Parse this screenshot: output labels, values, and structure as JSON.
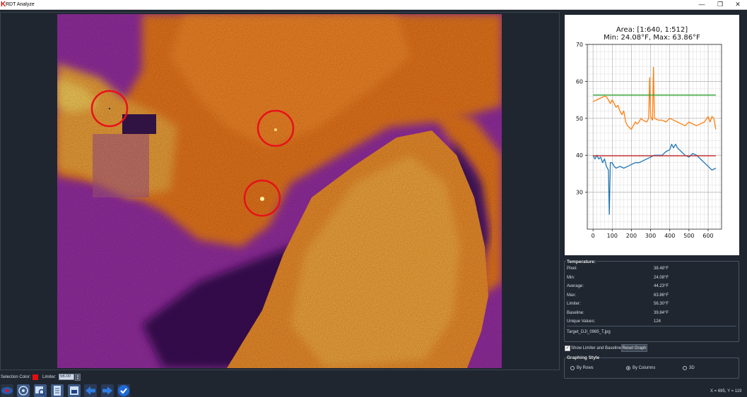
{
  "window": {
    "title": "RDT Analyze",
    "controls": {
      "minimize": "—",
      "maximize": "❐",
      "close": "✕"
    }
  },
  "graph": {
    "title_line1": "Area: [1:640, 1:512]",
    "title_line2": "Min: 24.08°F, Max: 63.86°F"
  },
  "chart_data": {
    "type": "line",
    "title": "Area: [1:640, 1:512] / Min: 24.08°F, Max: 63.86°F",
    "xlim": [
      -30,
      670
    ],
    "ylim": [
      20,
      70
    ],
    "x_ticks": [
      0,
      100,
      200,
      300,
      400,
      500,
      600
    ],
    "y_ticks": [
      30,
      40,
      50,
      60,
      70
    ],
    "grid": true,
    "series": [
      {
        "color": "#ff7f0e",
        "x": [
          0,
          20,
          40,
          60,
          70,
          80,
          90,
          100,
          110,
          120,
          130,
          140,
          150,
          160,
          170,
          180,
          190,
          200,
          210,
          220,
          230,
          240,
          250,
          260,
          280,
          290,
          295,
          300,
          305,
          310,
          315,
          320,
          340,
          360,
          380,
          400,
          420,
          440,
          460,
          480,
          500,
          520,
          540,
          560,
          580,
          600,
          610,
          620,
          630,
          640
        ],
        "y": [
          54.5,
          55,
          55.5,
          56,
          55.8,
          55,
          54,
          55,
          54,
          53,
          53.5,
          52,
          51,
          52,
          49,
          48,
          47.5,
          47,
          48,
          49,
          48.5,
          49,
          50,
          49.5,
          49,
          50,
          61,
          50.5,
          50,
          49.5,
          63.8,
          50,
          49.5,
          49.5,
          49,
          50,
          49.5,
          49,
          48.5,
          48,
          49,
          48.5,
          48,
          48.5,
          49,
          50.5,
          49,
          50.5,
          50,
          47
        ]
      },
      {
        "color": "#1f77b4",
        "x": [
          0,
          10,
          20,
          30,
          40,
          50,
          60,
          70,
          80,
          85,
          90,
          100,
          110,
          120,
          140,
          160,
          180,
          200,
          220,
          240,
          260,
          280,
          300,
          320,
          340,
          360,
          380,
          400,
          410,
          420,
          430,
          440,
          460,
          480,
          500,
          520,
          540,
          560,
          580,
          600,
          620,
          640
        ],
        "y": [
          40,
          39,
          40,
          39,
          39.5,
          38,
          39,
          37,
          36,
          24,
          38,
          38,
          37,
          36.5,
          37,
          36.5,
          37,
          37.5,
          38,
          38,
          38.5,
          39,
          39.5,
          40,
          40,
          40,
          41,
          41.5,
          43,
          42,
          43,
          42,
          41,
          40,
          39.5,
          40.5,
          40,
          39,
          38,
          37,
          36,
          36.5
        ]
      },
      {
        "color": "#2ca02c",
        "x": [
          0,
          640
        ],
        "y": [
          56.3,
          56.3
        ]
      },
      {
        "color": "#d62728",
        "x": [
          0,
          640
        ],
        "y": [
          39.84,
          39.84
        ]
      }
    ]
  },
  "stats": {
    "legend": "Temperature:",
    "rows": [
      {
        "label": "Pixel:",
        "value": "38.48°F"
      },
      {
        "label": "Min:",
        "value": "24.08°F"
      },
      {
        "label": "Average:",
        "value": "44.23°F"
      },
      {
        "label": "Max:",
        "value": "63.86°F"
      },
      {
        "label": "Limiter:",
        "value": "56.30°F"
      },
      {
        "label": "Baseline:",
        "value": "39.84°F"
      },
      {
        "label": "Unique Values:",
        "value": "124"
      }
    ],
    "file_name": "Target_DJI_0985_T.jpg"
  },
  "controls": {
    "show_limiter_label": "Show Limiter and Baseline",
    "show_limiter_checked": true,
    "reset_label": "Reset Graph",
    "style_legend": "Graphing Style",
    "style_options": [
      {
        "label": "By Rows",
        "selected": false
      },
      {
        "label": "By Columns",
        "selected": true
      },
      {
        "label": "3D",
        "selected": false
      }
    ]
  },
  "status": {
    "coords": "X = 695, Y = 119"
  },
  "toolbar": {
    "selection_label": "Selection Color:",
    "selection_color": "#e01010",
    "limiter_label": "Limiter:",
    "limiter_value": "56.00",
    "tools": [
      "eye-icon",
      "target-icon",
      "zoom-image-icon",
      "document-icon",
      "export-image-icon",
      "arrow-left-icon",
      "arrow-right-icon",
      "check-icon"
    ]
  }
}
